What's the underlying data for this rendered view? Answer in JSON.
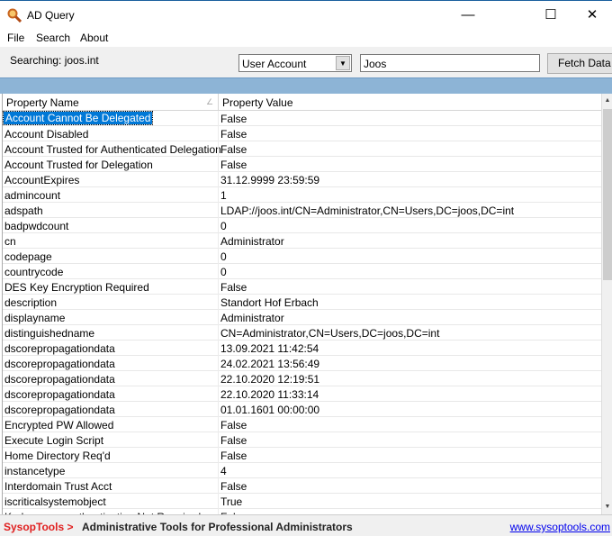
{
  "window": {
    "title": "AD Query",
    "icon": "magnifier-icon"
  },
  "menu": [
    "File",
    "Search",
    "About"
  ],
  "toolbar": {
    "searching": "Searching: joos.int",
    "object_type": "User Account",
    "search_value": "Joos",
    "fetch_label": "Fetch Data"
  },
  "table": {
    "columns": [
      "Property Name",
      "Property Value"
    ],
    "rows": [
      {
        "name": "Account Cannot Be Delegated",
        "value": "False"
      },
      {
        "name": "Account Disabled",
        "value": "False"
      },
      {
        "name": "Account Trusted for Authenticated Delegation",
        "value": "False"
      },
      {
        "name": "Account Trusted for Delegation",
        "value": "False"
      },
      {
        "name": "AccountExpires",
        "value": "31.12.9999 23:59:59"
      },
      {
        "name": "admincount",
        "value": "1"
      },
      {
        "name": "adspath",
        "value": "LDAP://joos.int/CN=Administrator,CN=Users,DC=joos,DC=int"
      },
      {
        "name": "badpwdcount",
        "value": "0"
      },
      {
        "name": "cn",
        "value": "Administrator"
      },
      {
        "name": "codepage",
        "value": "0"
      },
      {
        "name": "countrycode",
        "value": "0"
      },
      {
        "name": "DES Key Encryption Required",
        "value": "False"
      },
      {
        "name": "description",
        "value": "Standort Hof Erbach"
      },
      {
        "name": "displayname",
        "value": "Administrator"
      },
      {
        "name": "distinguishedname",
        "value": "CN=Administrator,CN=Users,DC=joos,DC=int"
      },
      {
        "name": "dscorepropagationdata",
        "value": "13.09.2021 11:42:54"
      },
      {
        "name": "dscorepropagationdata",
        "value": "24.02.2021 13:56:49"
      },
      {
        "name": "dscorepropagationdata",
        "value": "22.10.2020 12:19:51"
      },
      {
        "name": "dscorepropagationdata",
        "value": "22.10.2020 11:33:14"
      },
      {
        "name": "dscorepropagationdata",
        "value": "01.01.1601 00:00:00"
      },
      {
        "name": "Encrypted PW Allowed",
        "value": "False"
      },
      {
        "name": "Execute Login Script",
        "value": "False"
      },
      {
        "name": "Home Directory Req'd",
        "value": "False"
      },
      {
        "name": "instancetype",
        "value": "4"
      },
      {
        "name": "Interdomain Trust Acct",
        "value": "False"
      },
      {
        "name": "iscriticalsystemobject",
        "value": "True"
      },
      {
        "name": "Kerberos preauthentication Not Required",
        "value": "False"
      }
    ]
  },
  "footer": {
    "brand": "SysopTools >",
    "tagline": "Administrative Tools for Professional Administrators",
    "link": "www.sysoptools.com"
  }
}
